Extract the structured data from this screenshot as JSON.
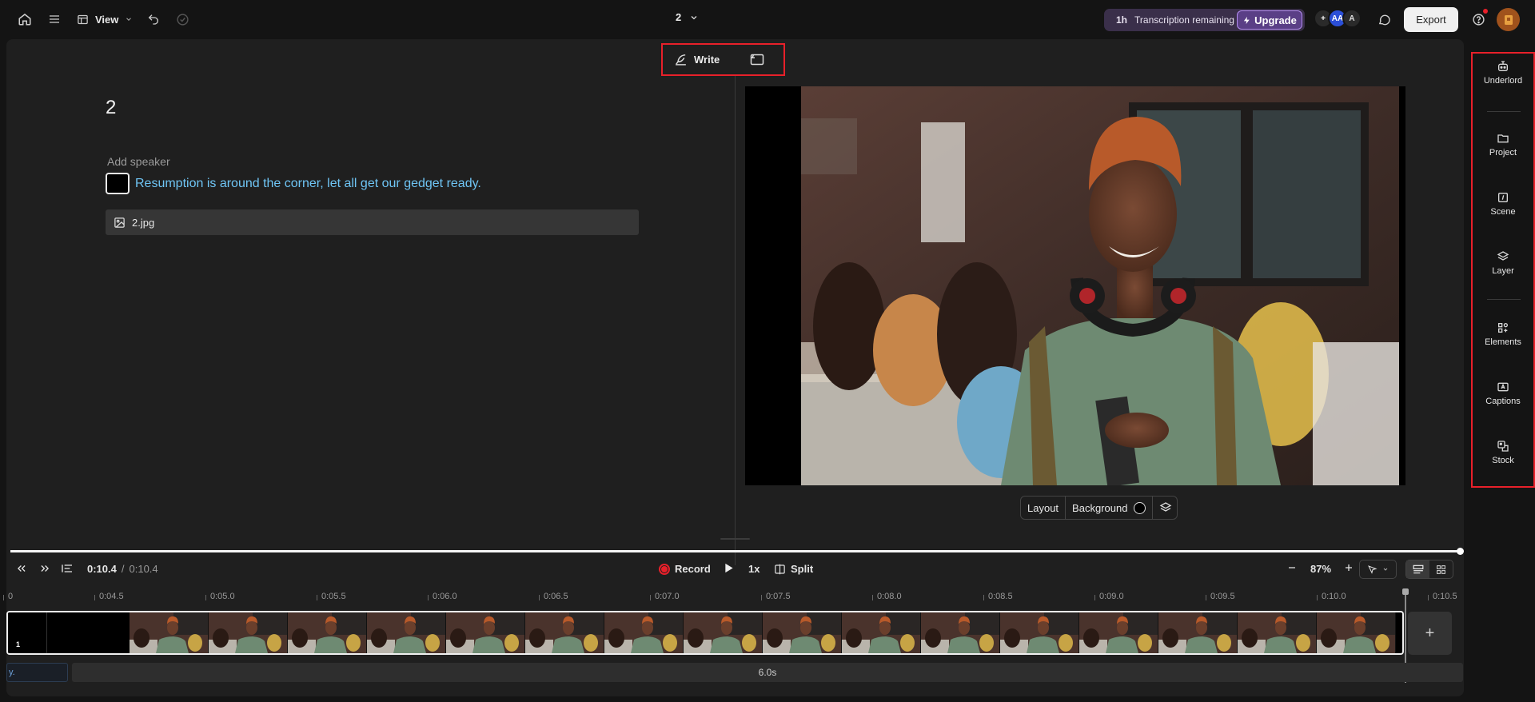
{
  "topbar": {
    "view_label": "View",
    "project_name": "2",
    "transcription_hours": "1h",
    "transcription_label": "Transcription remaining",
    "upgrade_label": "Upgrade",
    "avatar1": "AA",
    "avatar2": "A",
    "export_label": "Export"
  },
  "script": {
    "title": "2",
    "add_speaker": "Add speaker",
    "text": "Resumption is around the corner, let all get our gedget ready.",
    "media_file": "2.jpg"
  },
  "toolbar": {
    "write_label": "Write"
  },
  "preview_controls": {
    "layout_label": "Layout",
    "background_label": "Background"
  },
  "right_sidebar": {
    "items": [
      {
        "label": "Underlord",
        "icon": "robot-icon"
      },
      {
        "label": "Project",
        "icon": "folder-icon"
      },
      {
        "label": "Scene",
        "icon": "scene-icon"
      },
      {
        "label": "Layer",
        "icon": "layers-icon"
      },
      {
        "label": "Elements",
        "icon": "elements-icon"
      },
      {
        "label": "Captions",
        "icon": "captions-icon"
      },
      {
        "label": "Stock",
        "icon": "stock-icon"
      }
    ]
  },
  "transport": {
    "current_time": "0:10.4",
    "separator": "/",
    "total_time": "0:10.4",
    "record_label": "Record",
    "speed_label": "1x",
    "split_label": "Split",
    "zoom_label": "87%",
    "playhead_fraction": 1.0
  },
  "timeline": {
    "ruler": [
      "0",
      "0:04.5",
      "0:05.0",
      "0:05.5",
      "0:06.0",
      "0:06.5",
      "0:07.0",
      "0:07.5",
      "0:08.0",
      "0:08.5",
      "0:09.0",
      "0:09.5",
      "0:10.0",
      "0:10.5"
    ],
    "clip_number": "1",
    "add_label": "+",
    "audio_left_label": "y.",
    "audio_duration": "6.0s"
  },
  "colors": {
    "accent_red": "#e8202a",
    "script_text": "#6fc5f5",
    "upgrade_purple": "#5a3f86"
  }
}
